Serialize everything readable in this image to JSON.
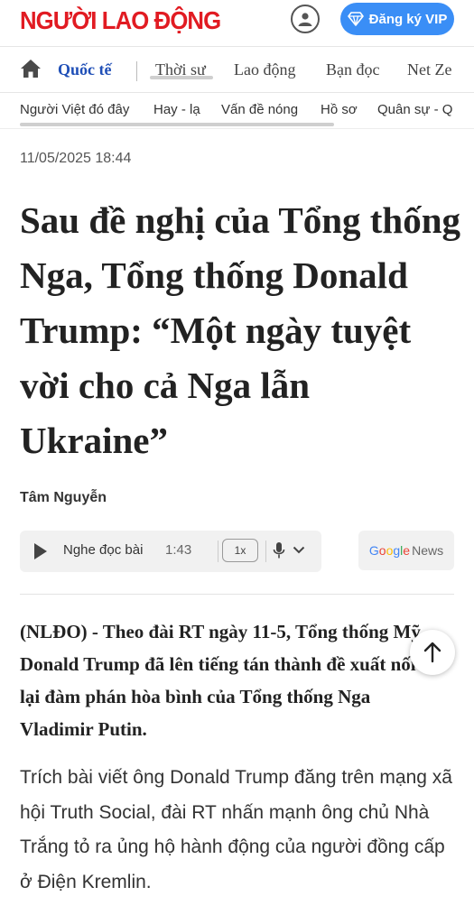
{
  "header": {
    "logo_text": "NGƯỜI LAO ĐỘNG",
    "user_icon": "user-circle-icon",
    "vip_label": "Đăng ký VIP",
    "vip_icon": "diamond-icon",
    "brand_color": "#e11b22",
    "vip_color": "#3a8ef6"
  },
  "nav": {
    "home_icon": "home-icon",
    "items": [
      "Quốc tế",
      "Thời sự",
      "Lao động",
      "Bạn đọc",
      "Net Ze"
    ],
    "active_color": "#1f4fb7"
  },
  "subnav": {
    "items": [
      "Người Việt đó đây",
      "Hay - lạ",
      "Vấn đề nóng",
      "Hồ sơ",
      "Quân sự - Q"
    ]
  },
  "article": {
    "timestamp": "11/05/2025 18:44",
    "title": "Sau đề nghị của Tổng thống Nga, Tổng thống Donald Trump: “Một ngày tuyệt vời cho cả Nga lẫn Ukraine”",
    "author": "Tâm Nguyễn",
    "lead": "(NLĐO) - Theo đài RT ngày 11-5, Tổng thống Mỹ Donald Trump đã lên tiếng tán thành đề xuất nối lại đàm phán hòa bình của Tổng thống Nga Vladimir Putin.",
    "body": "Trích bài viết ông Donald Trump đăng trên mạng xã hội Truth Social, đài RT nhấn mạnh ông chủ Nhà Trắng tỏ ra ủng hộ hành động của người đồng cấp ở Điện Kremlin."
  },
  "player": {
    "label": "Nghe đọc bài",
    "duration": "1:43",
    "speed": "1x"
  },
  "google_news": {
    "google": "Google",
    "news": "News",
    "letter_colors": [
      "#4285f4",
      "#ea4335",
      "#fbbc05",
      "#4285f4",
      "#34a853",
      "#ea4335"
    ]
  }
}
